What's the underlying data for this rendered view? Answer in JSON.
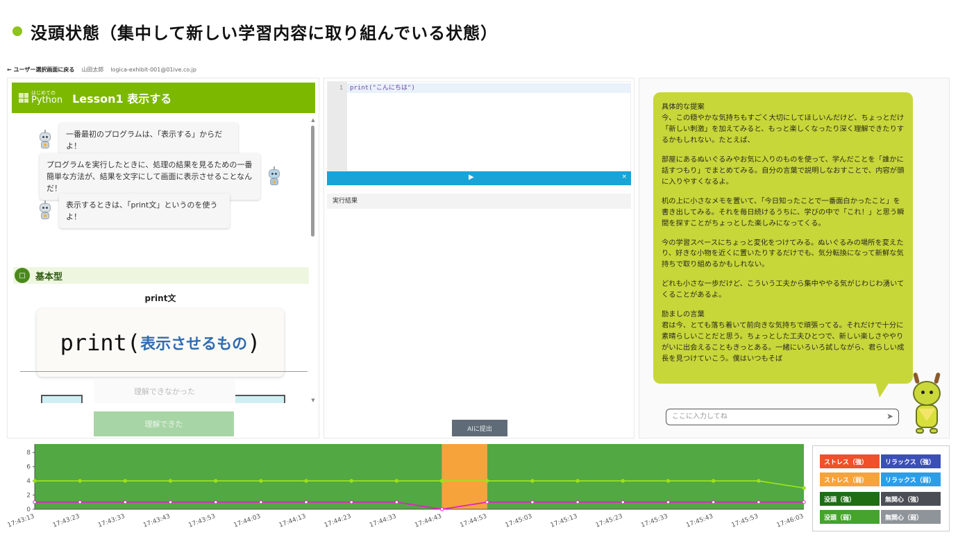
{
  "slide": {
    "title": "没頭状態（集中して新しい学習内容に取り組んでいる状態）"
  },
  "topbar": {
    "back": "← ユーザー選択画面に戻る",
    "user": "山田太郎",
    "email": "logica-exhibit-001@01ive.co.jp"
  },
  "lesson": {
    "logo_small": "はじめての",
    "logo_main": "Python",
    "title": "Lesson1 表示する",
    "messages": [
      "一番最初のプログラムは、「表示する」からだよ！",
      "プログラムを実行したときに、処理の結果を見るための一番簡単な方法が、結果を文字にして画面に表示させることなんだ！",
      "表示するときは、「print文」というのを使うよ！"
    ],
    "section": "基本型",
    "section_icon": "□",
    "print_label": "print文",
    "print_func": "print(",
    "print_arg": "表示させるもの",
    "print_close": ")",
    "btn_not": "理解できなかった",
    "btn_ok": "理解できた"
  },
  "editor": {
    "line_no": "1",
    "code": "print(\"こんにちは\")",
    "play": "▶",
    "close": "×",
    "result_label": "実行結果",
    "submit": "AIに提出"
  },
  "ai": {
    "paragraphs": [
      "具体的な提案\n今、この穏やかな気持ちもすごく大切にしてほしいんだけど、ちょっとだけ「新しい刺激」を加えてみると、もっと楽しくなったり深く理解できたりするかもしれない。たとえば、",
      "部屋にあるぬいぐるみやお気に入りのものを使って、学んだことを「誰かに話すつもり」でまとめてみる。自分の言葉で説明しなおすことで、内容が頭に入りやすくなるよ。",
      "机の上に小さなメモを置いて、「今日知ったことで一番面白かったこと」を書き出してみる。それを毎日続けるうちに、学びの中で「これ！」と思う瞬間を探すことがちょっとした楽しみになってくる。",
      "今の学習スペースにちょっと変化をつけてみる。ぬいぐるみの場所を変えたり、好きな小物を近くに置いたりするだけでも、気分転換になって新鮮な気持ちで取り組めるかもしれない。",
      "どれも小さな一歩だけど、こういう工夫から集中ややる気がじわじわ湧いてくることがあるよ。",
      "励ましの言葉\n君は今、とても落ち着いて前向きな気持ちで頑張ってる。それだけで十分に素晴らしいことだと思う。ちょっとした工夫ひとつで、新しい楽しさややりがいに出会えることもきっとある。一緒にいろいろ試しながら、君らしい成長を見つけていこう。僕はいつもそば"
    ],
    "input_placeholder": "ここに入力してね",
    "send_icon": "➤"
  },
  "legend": [
    {
      "label": "ストレス（強）",
      "color": "#f0502a"
    },
    {
      "label": "リラックス（強）",
      "color": "#3b4fb8"
    },
    {
      "label": "ストレス（弱）",
      "color": "#f6a33b"
    },
    {
      "label": "リラックス（弱）",
      "color": "#2a9ee8"
    },
    {
      "label": "没頭（強）",
      "color": "#1f6e14"
    },
    {
      "label": "無関心（強）",
      "color": "#4b4f55"
    },
    {
      "label": "没頭（弱）",
      "color": "#45a32e"
    },
    {
      "label": "無関心（弱）",
      "color": "#8e949a"
    }
  ],
  "chart_data": {
    "type": "line",
    "x": [
      "17:43:13",
      "17:43:23",
      "17:43:33",
      "17:43:43",
      "17:43:53",
      "17:44:03",
      "17:44:13",
      "17:44:23",
      "17:44:33",
      "17:44:43",
      "17:44:53",
      "17:45:03",
      "17:45:13",
      "17:45:23",
      "17:45:33",
      "17:45:43",
      "17:45:53",
      "17:46:03"
    ],
    "y_ticks": [
      0,
      2,
      4,
      6,
      8
    ],
    "ylim": [
      0,
      9
    ],
    "grid": false,
    "background_bands": [
      {
        "from": "17:43:13",
        "to": "17:44:43",
        "state": "没頭（弱）",
        "color": "#52a843"
      },
      {
        "from": "17:44:43",
        "to": "17:44:53",
        "state": "ストレス（弱）",
        "color": "#f6a33b"
      },
      {
        "from": "17:44:53",
        "to": "17:46:03",
        "state": "没頭（弱）",
        "color": "#52a843"
      }
    ],
    "series": [
      {
        "color": "#9be21f",
        "values": [
          4,
          4,
          4,
          4,
          4,
          4,
          4,
          4,
          4,
          4,
          4,
          4,
          4,
          4,
          4,
          4,
          4,
          3
        ]
      },
      {
        "color": "#e020c8",
        "values": [
          1,
          1,
          1,
          1,
          1,
          1,
          1,
          1,
          1,
          0,
          1,
          1,
          1,
          1,
          1,
          1,
          1,
          1
        ]
      }
    ]
  }
}
